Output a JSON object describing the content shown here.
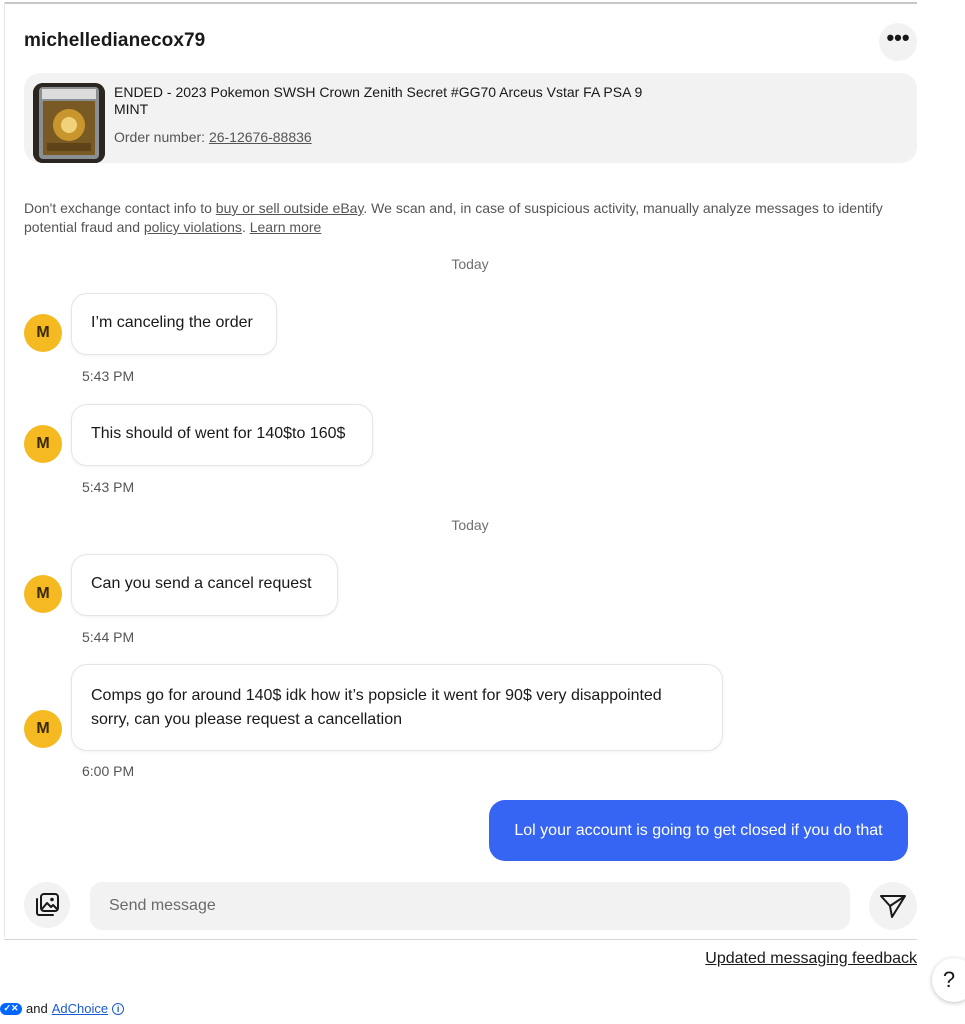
{
  "conversation": {
    "username": "michelledianecox79",
    "more_label": "•••"
  },
  "order": {
    "title": "ENDED - 2023 Pokemon SWSH Crown Zenith Secret #GG70 Arceus Vstar FA PSA 9 MINT",
    "number_label": "Order number: ",
    "number": "26-12676-88836"
  },
  "notice": {
    "part1": "Don't exchange contact info to ",
    "link1": "buy or sell outside eBay",
    "part2": ". We scan and, in case of suspicious activity, manually analyze messages to identify potential fraud and ",
    "link2": "policy violations",
    "part3": ". ",
    "link3": "Learn more"
  },
  "separators": [
    "Today",
    "Today"
  ],
  "messages": [
    {
      "avatar": "M",
      "text": "I’m canceling the order",
      "time": "5:43 PM"
    },
    {
      "avatar": "M",
      "text": "This should of went for 140$to 160$",
      "time": "5:43 PM"
    },
    {
      "avatar": "M",
      "text": "Can you send a cancel request",
      "time": "5:44 PM"
    },
    {
      "avatar": "M",
      "text": "Comps go for around 140$ idk how it’s popsicle it went for 90$ very disappointed sorry, can you please request a cancellation",
      "time": "6:00 PM"
    }
  ],
  "my_message": {
    "text": "Lol your account is going to get closed if you do that"
  },
  "composer": {
    "placeholder": "Send message",
    "gallery_icon": "image-gallery-icon",
    "send_icon": "send-icon"
  },
  "footer": {
    "feedback_link": "Updated messaging feedback",
    "help_label": "?",
    "and_text": "and",
    "adchoice_link": "AdChoice",
    "info_label": "i"
  },
  "colors": {
    "accent": "#3665f3",
    "avatar": "#f5b921",
    "surface": "#f2f2f2"
  }
}
